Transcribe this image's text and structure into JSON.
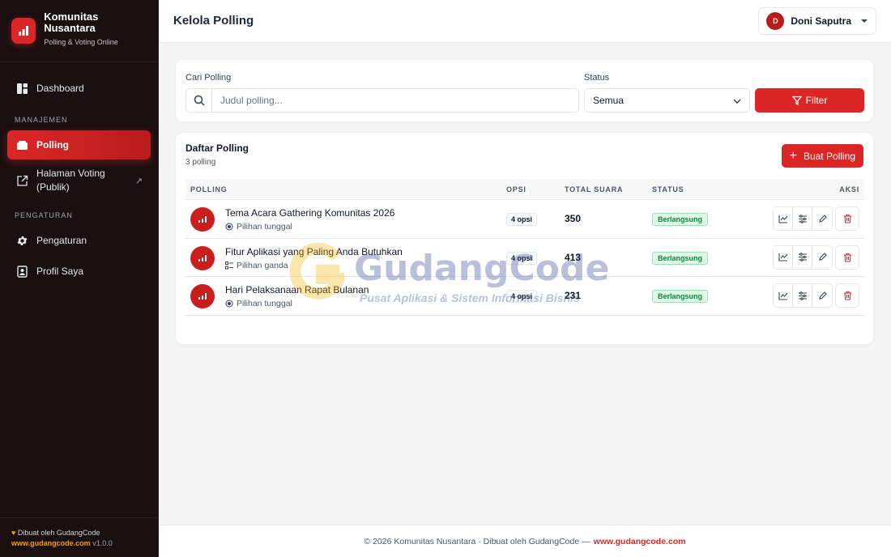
{
  "brand": {
    "name": "Komunitas Nusantara",
    "subtitle": "Polling & Voting Online"
  },
  "sidebar": {
    "items_main": [
      {
        "label": "Dashboard",
        "icon": "dashboard-icon"
      }
    ],
    "section_manage": "MANAJEMEN",
    "items_manage": [
      {
        "label": "Polling",
        "icon": "polling-icon",
        "active": true
      },
      {
        "label_line1": "Halaman Voting",
        "label_line2": "(Publik)",
        "icon": "external-link-icon"
      }
    ],
    "section_settings": "PENGATURAN",
    "items_settings": [
      {
        "label": "Pengaturan",
        "icon": "gear-icon"
      },
      {
        "label": "Profil Saya",
        "icon": "profile-icon"
      }
    ],
    "footer": {
      "made_by": "Dibuat oleh GudangCode",
      "url": "www.gudangcode.com",
      "version": "v1.0.0"
    }
  },
  "header": {
    "title": "Kelola Polling",
    "user": {
      "initial": "D",
      "name": "Doni Saputra"
    }
  },
  "filter": {
    "search_label": "Cari Polling",
    "search_placeholder": "Judul polling...",
    "status_label": "Status",
    "status_value": "Semua",
    "button_label": "Filter"
  },
  "list": {
    "title": "Daftar Polling",
    "count": "3 polling",
    "create_label": "Buat Polling",
    "columns": {
      "polling": "POLLING",
      "opsi": "OPSI",
      "total": "TOTAL SUARA",
      "status": "STATUS",
      "aksi": "AKSI"
    },
    "rows": [
      {
        "title": "Tema Acara Gathering Komunitas 2026",
        "type": "Pilihan tunggal",
        "type_icon": "radio-icon",
        "opsi": "4 opsi",
        "votes": "350",
        "status": "Berlangsung"
      },
      {
        "title": "Fitur Aplikasi yang Paling Anda Butuhkan",
        "type": "Pilihan ganda",
        "type_icon": "checklist-icon",
        "opsi": "4 opsi",
        "votes": "413",
        "status": "Berlangsung"
      },
      {
        "title": "Hari Pelaksanaan Rapat Bulanan",
        "type": "Pilihan tunggal",
        "type_icon": "radio-icon",
        "opsi": "4 opsi",
        "votes": "231",
        "status": "Berlangsung"
      }
    ]
  },
  "watermark": {
    "name": "GudangCode",
    "tagline": "Pusat Aplikasi & Sistem Informasi Bisnis"
  },
  "footer": {
    "text": "© 2026 Komunitas Nusantara · Dibuat oleh GudangCode —",
    "url": "www.gudangcode.com"
  },
  "colors": {
    "accent": "#dc2626",
    "sidebar_bg": "#1a0f11",
    "status_green": "#15803d"
  }
}
